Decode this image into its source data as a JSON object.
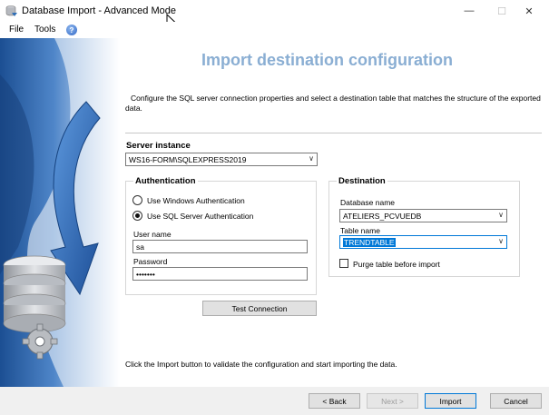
{
  "window": {
    "title": "Database Import - Advanced Mode",
    "min_glyph": "—",
    "max_glyph": "☐",
    "close_glyph": "✕"
  },
  "menu": {
    "file": "File",
    "tools": "Tools",
    "help_glyph": "?"
  },
  "header": {
    "title": "Import destination configuration",
    "intro_line1": "Configure the SQL server connection properties and select a destination table that matches the structure of the exported",
    "intro_line2": "data."
  },
  "server": {
    "label": "Server instance",
    "value": "WS16-FORM\\SQLEXPRESS2019"
  },
  "authentication": {
    "label": "Authentication",
    "windows_label": "Use Windows Authentication",
    "sql_label": "Use SQL Server Authentication",
    "selected": "sql",
    "username_label": "User name",
    "username_value": "sa",
    "password_label": "Password",
    "password_value": "•••••••"
  },
  "destination": {
    "label": "Destination",
    "database_label": "Database name",
    "database_value": "ATELIERS_PCVUEDB",
    "table_label": "Table name",
    "table_value": "TRENDTABLE",
    "purge_label": "Purge table before import",
    "purge_checked": false
  },
  "test_connection": "Test Connection",
  "footer_note": "Click the Import button to validate the configuration and start importing the data.",
  "nav": {
    "back": "< Back",
    "next": "Next >",
    "import": "Import",
    "cancel": "Cancel"
  },
  "colors": {
    "title": "#8aaed3",
    "accent": "#0078d7",
    "art_blue": "#2f6fb7"
  },
  "dropdown_glyph": "∨"
}
